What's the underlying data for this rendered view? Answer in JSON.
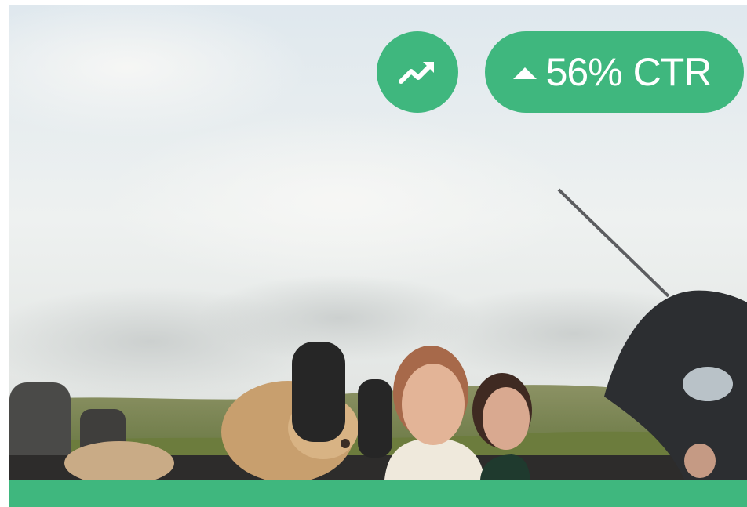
{
  "colors": {
    "accent": "#3fb77e",
    "sky": "#e8eef1",
    "field": "#7f8a4b"
  },
  "badge": {
    "icon": "trending-up-icon"
  },
  "stat": {
    "icon": "caret-up-icon",
    "value": "56%",
    "unit": "CTR"
  }
}
